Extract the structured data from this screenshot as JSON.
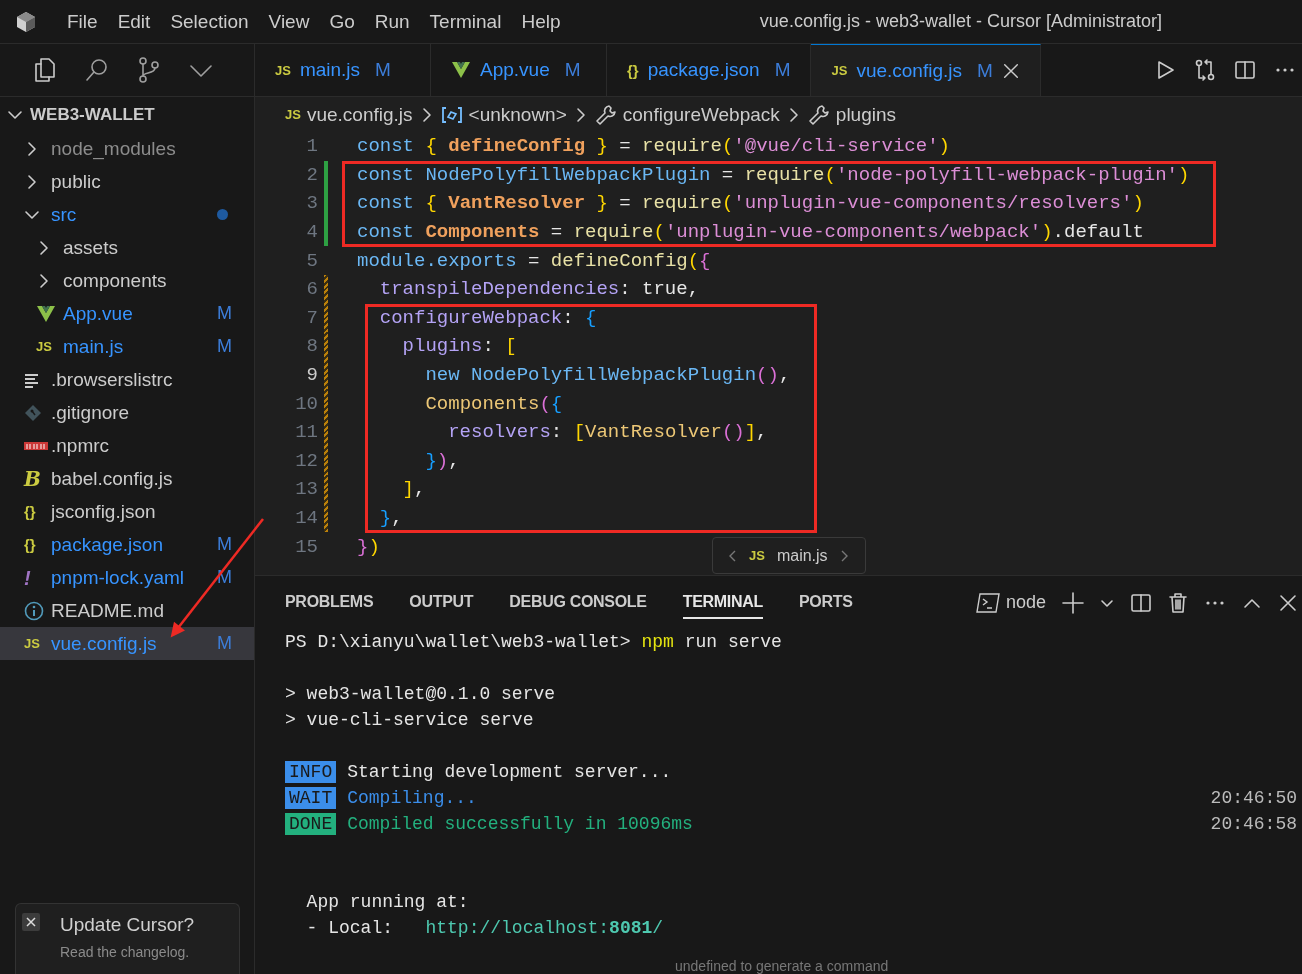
{
  "title_bar": {
    "menus": [
      "File",
      "Edit",
      "Selection",
      "View",
      "Go",
      "Run",
      "Terminal",
      "Help"
    ],
    "title": "vue.config.js - web3-wallet - Cursor [Administrator]"
  },
  "activity": [
    {
      "kind": "explorer",
      "selected": true
    },
    {
      "kind": "search",
      "selected": false
    },
    {
      "kind": "branch",
      "selected": false
    },
    {
      "kind": "chevron",
      "selected": false
    }
  ],
  "explorer": {
    "title": "WEB3-WALLET",
    "expanded": true,
    "items": [
      {
        "kind": "folder",
        "label": "node_modules",
        "expanded": false,
        "ignored": true,
        "modified": false
      },
      {
        "kind": "folder",
        "label": "public",
        "expanded": false,
        "ignored": false,
        "modified": false
      },
      {
        "kind": "folder",
        "label": "src",
        "expanded": true,
        "ignored": false,
        "modified": true,
        "dot": true,
        "children": [
          {
            "kind": "folder",
            "label": "assets",
            "expanded": false,
            "ignored": false,
            "modified": false
          },
          {
            "kind": "folder",
            "label": "components",
            "expanded": false,
            "ignored": false,
            "modified": false
          },
          {
            "kind": "file",
            "label": "App.vue",
            "icon": {
              "kind": "vue"
            },
            "modified": true,
            "status": "M",
            "selected": false
          },
          {
            "kind": "file",
            "label": "main.js",
            "icon": {
              "kind": "js",
              "text": "JS"
            },
            "modified": true,
            "status": "M",
            "selected": false
          }
        ]
      },
      {
        "kind": "file",
        "label": ".browserslistrc",
        "icon": {
          "kind": "lines"
        },
        "modified": false,
        "selected": false
      },
      {
        "kind": "file",
        "label": ".gitignore",
        "icon": {
          "kind": "git"
        },
        "modified": false,
        "selected": false
      },
      {
        "kind": "file",
        "label": ".npmrc",
        "icon": {
          "kind": "npm"
        },
        "modified": false,
        "selected": false
      },
      {
        "kind": "file",
        "label": "babel.config.js",
        "icon": {
          "kind": "babel",
          "text": "B"
        },
        "modified": false,
        "selected": false
      },
      {
        "kind": "file",
        "label": "jsconfig.json",
        "icon": {
          "kind": "json",
          "text": "{}"
        },
        "modified": false,
        "selected": false
      },
      {
        "kind": "file",
        "label": "package.json",
        "icon": {
          "kind": "json",
          "text": "{}"
        },
        "modified": true,
        "status": "M",
        "selected": false
      },
      {
        "kind": "file",
        "label": "pnpm-lock.yaml",
        "icon": {
          "kind": "yaml",
          "text": "!"
        },
        "modified": true,
        "status": "M",
        "selected": false
      },
      {
        "kind": "file",
        "label": "README.md",
        "icon": {
          "kind": "info"
        },
        "modified": false,
        "selected": false
      },
      {
        "kind": "file",
        "label": "vue.config.js",
        "icon": {
          "kind": "js",
          "text": "JS"
        },
        "modified": true,
        "status": "M",
        "selected": true
      }
    ]
  },
  "notification": {
    "title": "Update Cursor?",
    "message": "Read the changelog."
  },
  "tabs": [
    {
      "label": "main.js",
      "icon": {
        "kind": "js",
        "text": "JS"
      },
      "status": "M",
      "selected": false
    },
    {
      "label": "App.vue",
      "icon": {
        "kind": "vue"
      },
      "status": "M",
      "selected": false
    },
    {
      "label": "package.json",
      "icon": {
        "kind": "json",
        "text": "{}"
      },
      "status": "M",
      "selected": false
    },
    {
      "label": "vue.config.js",
      "icon": {
        "kind": "js",
        "text": "JS"
      },
      "status": "M",
      "selected": true
    }
  ],
  "editor_actions": [
    {
      "kind": "run"
    },
    {
      "kind": "compare"
    },
    {
      "kind": "split"
    },
    {
      "kind": "more"
    }
  ],
  "breadcrumb": [
    {
      "icon": {
        "kind": "js",
        "text": "JS"
      },
      "label": "vue.config.js"
    },
    {
      "icon": {
        "kind": "symbol"
      },
      "label": "<unknown>"
    },
    {
      "icon": {
        "kind": "wrench"
      },
      "label": "configureWebpack"
    },
    {
      "icon": {
        "kind": "wrench"
      },
      "label": "plugins"
    }
  ],
  "code": [
    {
      "number": "1",
      "added": false,
      "modified": false,
      "current": false,
      "boxed": false,
      "arrow": false,
      "tokens": [
        {
          "text": "const ",
          "kind": "kw"
        },
        {
          "text": "{",
          "kind": "b1"
        },
        {
          "text": " defineConfig ",
          "kind": "decl"
        },
        {
          "text": "}",
          "kind": "b1"
        },
        {
          "text": " = ",
          "kind": "p"
        },
        {
          "text": "require",
          "kind": "fn"
        },
        {
          "text": "(",
          "kind": "b1"
        },
        {
          "text": "'@vue/cli-service'",
          "kind": "str"
        },
        {
          "text": ")",
          "kind": "b1"
        }
      ]
    },
    {
      "number": "2",
      "added": true,
      "modified": false,
      "current": false,
      "boxed": true,
      "arrow": false,
      "tokens": [
        {
          "text": "const ",
          "kind": "kw"
        },
        {
          "text": "NodePolyfillWebpackPlugin",
          "kind": "cls"
        },
        {
          "text": " = ",
          "kind": "p"
        },
        {
          "text": "require",
          "kind": "fn"
        },
        {
          "text": "(",
          "kind": "b1"
        },
        {
          "text": "'node-polyfill-webpack-plugin'",
          "kind": "str"
        },
        {
          "text": ")",
          "kind": "b1"
        }
      ]
    },
    {
      "number": "3",
      "added": true,
      "modified": false,
      "current": false,
      "boxed": true,
      "arrow": false,
      "tokens": [
        {
          "text": "const ",
          "kind": "kw"
        },
        {
          "text": "{",
          "kind": "b1"
        },
        {
          "text": " VantResolver ",
          "kind": "decl"
        },
        {
          "text": "}",
          "kind": "b1"
        },
        {
          "text": " = ",
          "kind": "p"
        },
        {
          "text": "require",
          "kind": "fn"
        },
        {
          "text": "(",
          "kind": "b1"
        },
        {
          "text": "'unplugin-vue-components/resolvers'",
          "kind": "str"
        },
        {
          "text": ")",
          "kind": "b1"
        }
      ]
    },
    {
      "number": "4",
      "added": true,
      "modified": false,
      "current": false,
      "boxed": true,
      "arrow": false,
      "tokens": [
        {
          "text": "const ",
          "kind": "kw"
        },
        {
          "text": "Components",
          "kind": "decl"
        },
        {
          "text": " = ",
          "kind": "p"
        },
        {
          "text": "require",
          "kind": "fn"
        },
        {
          "text": "(",
          "kind": "b1"
        },
        {
          "text": "'unplugin-vue-components/webpack'",
          "kind": "str"
        },
        {
          "text": ")",
          "kind": "b1"
        },
        {
          "text": ".default",
          "kind": "p"
        }
      ]
    },
    {
      "number": "5",
      "added": false,
      "modified": false,
      "current": false,
      "boxed": false,
      "arrow": false,
      "tokens": [
        {
          "text": "module.exports",
          "kind": "kw"
        },
        {
          "text": " = ",
          "kind": "p"
        },
        {
          "text": "defineConfig",
          "kind": "fn"
        },
        {
          "text": "(",
          "kind": "b1"
        },
        {
          "text": "{",
          "kind": "b2"
        }
      ]
    },
    {
      "number": "6",
      "added": false,
      "modified": true,
      "current": false,
      "boxed": false,
      "arrow": false,
      "tokens": [
        {
          "text": "  transpileDependencies",
          "kind": "prop"
        },
        {
          "text": ": true,",
          "kind": "p"
        }
      ]
    },
    {
      "number": "7",
      "added": false,
      "modified": true,
      "current": false,
      "boxed": true,
      "arrow": false,
      "tokens": [
        {
          "text": "  configureWebpack",
          "kind": "prop"
        },
        {
          "text": ": ",
          "kind": "p"
        },
        {
          "text": "{",
          "kind": "b3"
        }
      ]
    },
    {
      "number": "8",
      "added": false,
      "modified": true,
      "current": false,
      "boxed": true,
      "arrow": false,
      "tokens": [
        {
          "text": "    plugins",
          "kind": "prop"
        },
        {
          "text": ": ",
          "kind": "p"
        },
        {
          "text": "[",
          "kind": "b1"
        }
      ]
    },
    {
      "number": "9",
      "added": false,
      "modified": true,
      "current": true,
      "boxed": true,
      "arrow": false,
      "tokens": [
        {
          "text": "      new ",
          "kind": "kw"
        },
        {
          "text": "NodePolyfillWebpackPlugin",
          "kind": "cls"
        },
        {
          "text": "()",
          "kind": "b2"
        },
        {
          "text": ",",
          "kind": "p"
        }
      ]
    },
    {
      "number": "10",
      "added": false,
      "modified": true,
      "current": false,
      "boxed": true,
      "arrow": false,
      "tokens": [
        {
          "text": "      Components",
          "kind": "ctor"
        },
        {
          "text": "(",
          "kind": "b2"
        },
        {
          "text": "{",
          "kind": "b3"
        }
      ]
    },
    {
      "number": "11",
      "added": false,
      "modified": true,
      "current": false,
      "boxed": true,
      "arrow": false,
      "tokens": [
        {
          "text": "        resolvers",
          "kind": "prop"
        },
        {
          "text": ": ",
          "kind": "p"
        },
        {
          "text": "[",
          "kind": "b1"
        },
        {
          "text": "VantResolver",
          "kind": "ctor"
        },
        {
          "text": "()",
          "kind": "b2"
        },
        {
          "text": "]",
          "kind": "b1"
        },
        {
          "text": ",",
          "kind": "p"
        }
      ]
    },
    {
      "number": "12",
      "added": false,
      "modified": true,
      "current": false,
      "boxed": true,
      "arrow": false,
      "tokens": [
        {
          "text": "      }",
          "kind": "b3"
        },
        {
          "text": ")",
          "kind": "b2"
        },
        {
          "text": ",",
          "kind": "p"
        }
      ]
    },
    {
      "number": "13",
      "added": false,
      "modified": true,
      "current": false,
      "boxed": true,
      "arrow": false,
      "tokens": [
        {
          "text": "    ]",
          "kind": "b1"
        },
        {
          "text": ",",
          "kind": "p"
        }
      ]
    },
    {
      "number": "14",
      "added": false,
      "modified": true,
      "current": false,
      "boxed": true,
      "arrow": true,
      "tokens": [
        {
          "text": "  }",
          "kind": "b3"
        },
        {
          "text": ",",
          "kind": "p"
        }
      ]
    },
    {
      "number": "15",
      "added": false,
      "modified": false,
      "current": false,
      "boxed": false,
      "arrow": false,
      "tokens": [
        {
          "text": "}",
          "kind": "b2"
        },
        {
          "text": ")",
          "kind": "b1"
        }
      ]
    }
  ],
  "peek": {
    "icon": {
      "kind": "js",
      "text": "JS"
    },
    "label": "main.js"
  },
  "panel": {
    "tabs": [
      {
        "label": "PROBLEMS",
        "selected": false
      },
      {
        "label": "OUTPUT",
        "selected": false
      },
      {
        "label": "DEBUG CONSOLE",
        "selected": false
      },
      {
        "label": "TERMINAL",
        "selected": true
      },
      {
        "label": "PORTS",
        "selected": false
      }
    ],
    "terminal_name": "node",
    "actions": [
      {
        "kind": "plus"
      },
      {
        "kind": "chevron"
      },
      {
        "kind": "split"
      },
      {
        "kind": "trash"
      },
      {
        "kind": "more"
      },
      {
        "kind": "up"
      },
      {
        "kind": "close"
      }
    ],
    "lines": [
      {
        "kind": "text",
        "segments": [
          {
            "text": "PS D:\\xianyu\\wallet\\web3-wallet> ",
            "kind": "plain"
          },
          {
            "text": "npm",
            "kind": "cmd"
          },
          {
            "text": " run serve",
            "kind": "plain"
          }
        ]
      },
      {
        "kind": "blank"
      },
      {
        "kind": "text",
        "segments": [
          {
            "text": "> web3-wallet@0.1.0 serve",
            "kind": "plain"
          }
        ]
      },
      {
        "kind": "text",
        "segments": [
          {
            "text": "> vue-cli-service serve",
            "kind": "plain"
          }
        ]
      },
      {
        "kind": "blank"
      },
      {
        "kind": "text",
        "badge": {
          "text": "INFO",
          "kind": "info"
        },
        "segments": [
          {
            "text": "Starting development server...",
            "kind": "plain"
          }
        ]
      },
      {
        "kind": "text",
        "badge": {
          "text": "WAIT",
          "kind": "info"
        },
        "segments": [
          {
            "text": "Compiling...",
            "kind": "blue"
          }
        ],
        "time": "20:46:50"
      },
      {
        "kind": "text",
        "badge": {
          "text": "DONE",
          "kind": "done"
        },
        "segments": [
          {
            "text": "Compiled successfully in 10096ms",
            "kind": "green"
          }
        ],
        "time": "20:46:58"
      },
      {
        "kind": "blank"
      },
      {
        "kind": "blank"
      },
      {
        "kind": "text",
        "segments": [
          {
            "text": "  App running at:",
            "kind": "plain"
          }
        ]
      },
      {
        "kind": "text",
        "segments": [
          {
            "text": "  - Local:   ",
            "kind": "plain"
          },
          {
            "text": "http://localhost:",
            "kind": "link"
          },
          {
            "text": "8081",
            "kind": "linkbold"
          },
          {
            "text": "/",
            "kind": "link"
          }
        ]
      }
    ],
    "hint": "undefined to generate a command"
  }
}
